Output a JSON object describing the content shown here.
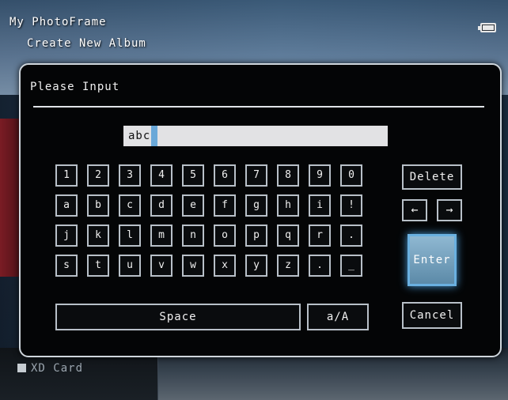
{
  "app": {
    "title": "My PhotoFrame",
    "subtitle": "Create New Album"
  },
  "status": {
    "battery_icon": "battery-icon"
  },
  "background": {
    "xd_card_label": "XD Card"
  },
  "dialog": {
    "title": "Please Input",
    "input_value": "abc",
    "keyboard": {
      "rows": [
        [
          "1",
          "2",
          "3",
          "4",
          "5",
          "6",
          "7",
          "8",
          "9",
          "0"
        ],
        [
          "a",
          "b",
          "c",
          "d",
          "e",
          "f",
          "g",
          "h",
          "i",
          "!"
        ],
        [
          "j",
          "k",
          "l",
          "m",
          "n",
          "o",
          "p",
          "q",
          "r",
          "."
        ],
        [
          "s",
          "t",
          "u",
          "v",
          "w",
          "x",
          "y",
          "z",
          ".",
          "_"
        ]
      ],
      "space_label": "Space",
      "case_label": "a/A",
      "delete_label": "Delete",
      "left_arrow": "←",
      "right_arrow": "→",
      "enter_label": "Enter",
      "cancel_label": "Cancel"
    }
  },
  "colors": {
    "accent": "#6ab0e0",
    "dialog_bg": "#040506",
    "border": "#b8c0c8"
  }
}
